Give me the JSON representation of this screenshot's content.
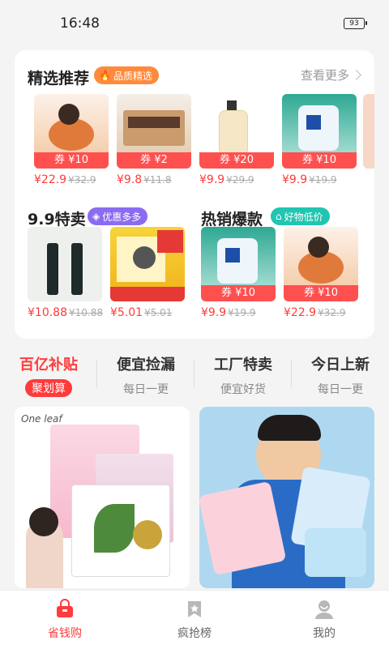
{
  "status": {
    "time": "16:48",
    "battery": "93"
  },
  "selected": {
    "title": "精选推荐",
    "tag": "品质精选",
    "more": "查看更多",
    "products": [
      {
        "coupon": "券 ¥10",
        "price": "¥22.9",
        "old": "¥32.9"
      },
      {
        "coupon": "券 ¥2",
        "price": "¥9.8",
        "old": "¥11.8"
      },
      {
        "coupon": "券 ¥20",
        "price": "¥9.9",
        "old": "¥29.9"
      },
      {
        "coupon": "券 ¥10",
        "price": "¥9.9",
        "old": "¥19.9"
      }
    ]
  },
  "special": {
    "title": "9.9特卖",
    "tag": "优惠多多",
    "products": [
      {
        "price": "¥10.88",
        "old": "¥10.88"
      },
      {
        "price": "¥5.01",
        "old": "¥5.01"
      }
    ]
  },
  "hot": {
    "title": "热销爆款",
    "tag": "好物低价",
    "products": [
      {
        "coupon": "券 ¥10",
        "price": "¥9.9",
        "old": "¥19.9"
      },
      {
        "coupon": "券 ¥10",
        "price": "¥22.9",
        "old": "¥32.9"
      }
    ]
  },
  "tabs": [
    {
      "title": "百亿补贴",
      "sub": "聚划算"
    },
    {
      "title": "便宜捡漏",
      "sub": "每日一更"
    },
    {
      "title": "工厂特卖",
      "sub": "便宜好货"
    },
    {
      "title": "今日上新",
      "sub": "每日一更"
    }
  ],
  "banners": {
    "left_brand": "One leaf"
  },
  "nav": [
    {
      "label": "省钱购",
      "icon": "shopping-basket-icon"
    },
    {
      "label": "疯抢榜",
      "icon": "bookmark-star-icon"
    },
    {
      "label": "我的",
      "icon": "profile-icon"
    }
  ],
  "colors": {
    "accent": "#ff3b3b",
    "orange": "#ff8a3c",
    "purple": "#8b6cf0",
    "teal": "#20c6b0"
  }
}
